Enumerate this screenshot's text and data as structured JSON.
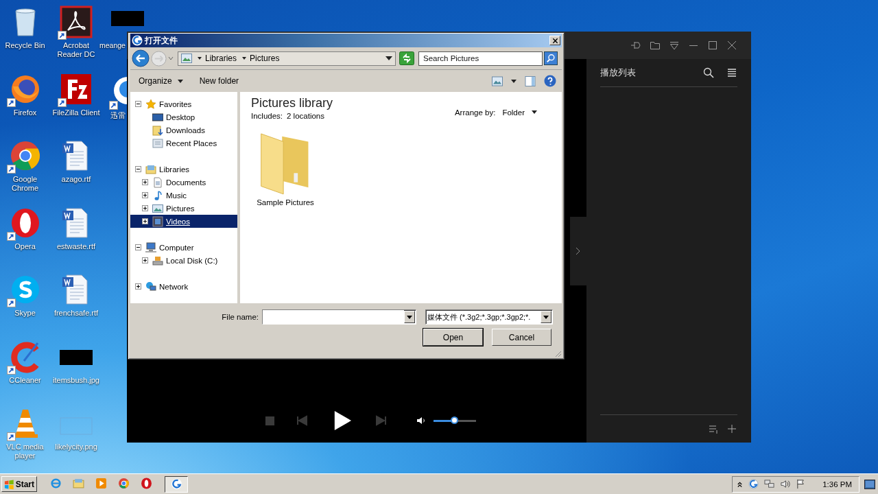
{
  "desktop_icons": [
    {
      "label": "Recycle Bin",
      "shortcut": false
    },
    {
      "label": "Acrobat Reader DC",
      "shortcut": true
    },
    {
      "label": "Firefox",
      "shortcut": true
    },
    {
      "label": "FileZilla Client",
      "shortcut": true
    },
    {
      "label": "Google Chrome",
      "shortcut": true
    },
    {
      "label": "azago.rtf",
      "shortcut": false
    },
    {
      "label": "Opera",
      "shortcut": true
    },
    {
      "label": "estwaste.rtf",
      "shortcut": false
    },
    {
      "label": "Skype",
      "shortcut": true
    },
    {
      "label": "frenchsafe.rtf",
      "shortcut": false
    },
    {
      "label": "CCleaner",
      "shortcut": true
    },
    {
      "label": "itemsbush.jpg",
      "shortcut": false
    },
    {
      "label": "VLC media player",
      "shortcut": true
    },
    {
      "label": "likelycity.png",
      "shortcut": false
    }
  ],
  "desktop_icons_partial": [
    {
      "label": "meange",
      "shortcut": false
    },
    {
      "label": "迅雷",
      "shortcut": true
    }
  ],
  "player": {
    "playlist_title": "播放列表",
    "volume": {
      "level": 0.48
    }
  },
  "dialog": {
    "title": "打开文件",
    "address": [
      "Libraries",
      "Pictures"
    ],
    "search": {
      "placeholder": "Search Pictures"
    },
    "toolbar": [
      {
        "label": "Organize",
        "dropdown": true
      },
      {
        "label": "New folder",
        "dropdown": false
      }
    ],
    "tree": [
      {
        "label": "Favorites",
        "expanded": true,
        "selected": false,
        "children": [
          {
            "label": "Desktop",
            "selected": false
          },
          {
            "label": "Downloads",
            "selected": false
          },
          {
            "label": "Recent Places",
            "selected": false
          }
        ]
      },
      {
        "label": "Libraries",
        "expanded": true,
        "selected": false,
        "children": [
          {
            "label": "Documents",
            "expanded": false,
            "selected": false
          },
          {
            "label": "Music",
            "expanded": false,
            "selected": false
          },
          {
            "label": "Pictures",
            "expanded": false,
            "selected": false
          },
          {
            "label": "Videos",
            "expanded": false,
            "selected": true
          }
        ]
      },
      {
        "label": "Computer",
        "expanded": true,
        "selected": false,
        "children": [
          {
            "label": "Local Disk (C:)",
            "expanded": false,
            "selected": false
          }
        ]
      },
      {
        "label": "Network",
        "expanded": false,
        "selected": false
      }
    ],
    "library_title": "Pictures library",
    "includes_label": "Includes:",
    "includes_link": "2 locations",
    "arrange_label": "Arrange by:",
    "arrange_value": "Folder",
    "items": [
      {
        "label": "Sample Pictures"
      }
    ],
    "file_name_label": "File name:",
    "filter": "媒体文件 (*.3g2;*.3gp;*.3gp2;*.",
    "buttons": [
      {
        "label": "Open",
        "default": true
      },
      {
        "label": "Cancel",
        "default": false
      }
    ]
  },
  "taskbar": {
    "start": "Start",
    "programs": [
      {
        "selected": false
      },
      {
        "selected": false
      },
      {
        "selected": false
      },
      {
        "selected": false
      },
      {
        "selected": false
      },
      {
        "selected": true
      }
    ],
    "time": "1:36 PM"
  }
}
